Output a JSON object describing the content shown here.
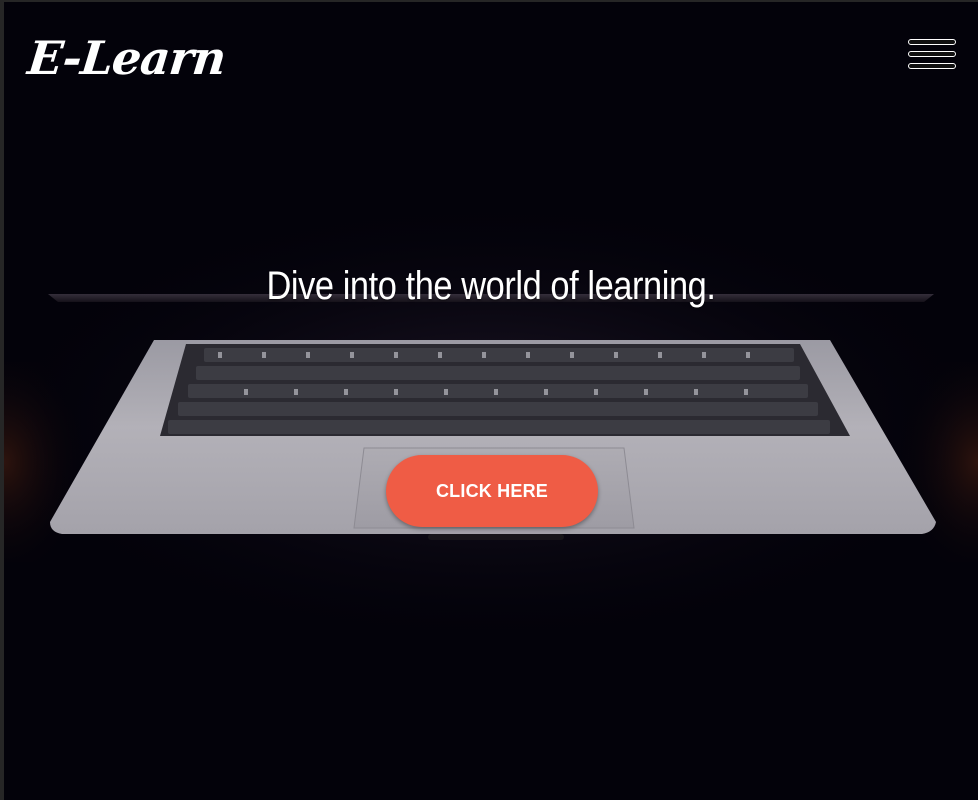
{
  "header": {
    "logo_text": "E-Learn",
    "menu_icon": "hamburger-menu-icon"
  },
  "hero": {
    "headline": "Dive into the world of learning.",
    "cta_label": "CLICK HERE",
    "cta_color": "#ef5c45",
    "background_image": "laptop-keyboard-photo"
  }
}
